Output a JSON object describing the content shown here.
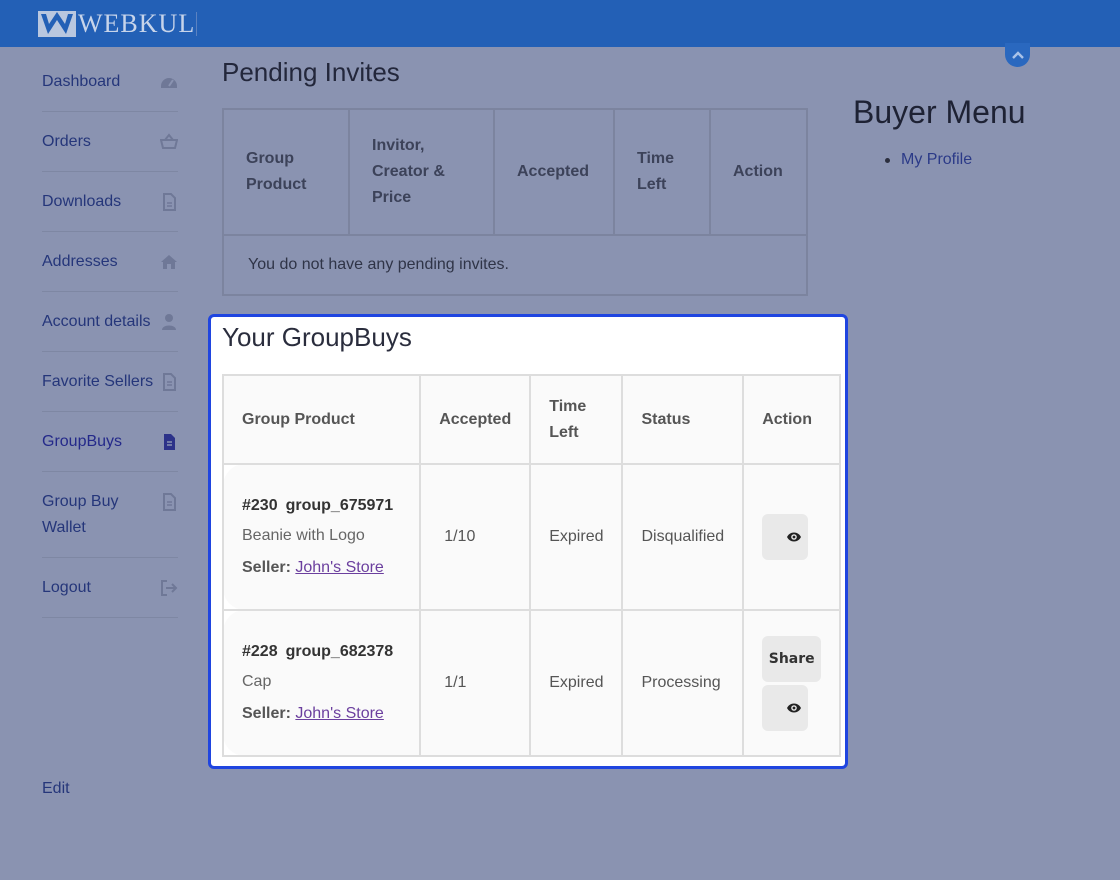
{
  "header": {
    "brand": "WEBKUL"
  },
  "sidebar": {
    "items": [
      {
        "label": "Dashboard",
        "icon": "dashboard-icon"
      },
      {
        "label": "Orders",
        "icon": "basket-icon"
      },
      {
        "label": "Downloads",
        "icon": "file-icon"
      },
      {
        "label": "Addresses",
        "icon": "home-icon"
      },
      {
        "label": "Account details",
        "icon": "user-icon"
      },
      {
        "label": "Favorite Sellers",
        "icon": "document-icon"
      },
      {
        "label": "GroupBuys",
        "icon": "document-icon"
      },
      {
        "label": "Group Buy Wallet",
        "icon": "document-icon"
      },
      {
        "label": "Logout",
        "icon": "sign-out-icon"
      }
    ],
    "edit_label": "Edit"
  },
  "pending": {
    "title": "Pending Invites",
    "headers": [
      "Group Product",
      "Invitor, Creator & Price",
      "Accepted",
      "Time Left",
      "Action"
    ],
    "empty_message": "You do not have any pending invites."
  },
  "buyer_menu": {
    "title": "Buyer Menu",
    "items": [
      "My Profile"
    ]
  },
  "groupbuys": {
    "title": "Your GroupBuys",
    "headers": [
      "Group Product",
      "Accepted",
      "Time Left",
      "Status",
      "Action"
    ],
    "seller_label": "Seller:",
    "rows": [
      {
        "id": "#230",
        "group": "group_675971",
        "product": "Beanie with Logo",
        "seller": "John's Store",
        "accepted": "1/10",
        "time_left": "Expired",
        "status": "Disqualified",
        "share_label": ""
      },
      {
        "id": "#228",
        "group": "group_682378",
        "product": "Cap",
        "seller": "John's Store",
        "accepted": "1/1",
        "time_left": "Expired",
        "status": "Processing",
        "share_label": "Share"
      }
    ]
  },
  "colors": {
    "header": "#2360b6",
    "spotlight_border": "#1f45e0",
    "link": "#6b3f9e"
  }
}
